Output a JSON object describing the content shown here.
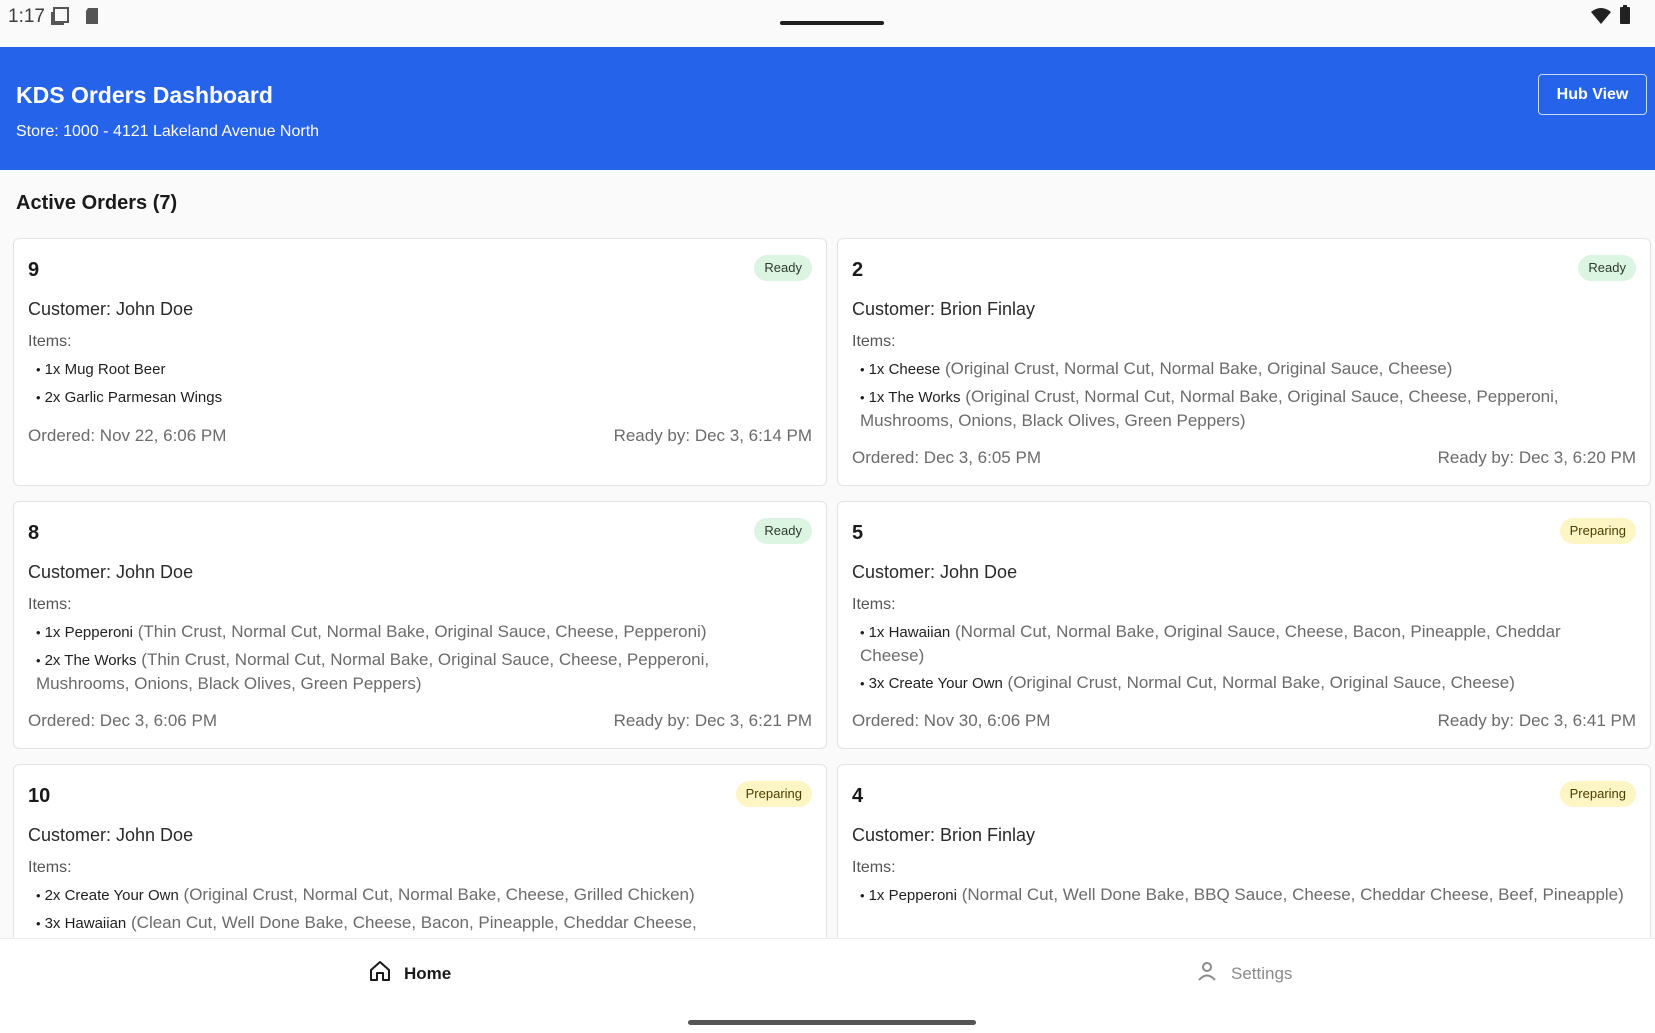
{
  "status_bar": {
    "time": "1:17"
  },
  "header": {
    "title": "KDS Orders Dashboard",
    "subtitle": "Store: 1000 - 4121 Lakeland Avenue North",
    "hub_button": "Hub View"
  },
  "section_title": "Active Orders (7)",
  "labels": {
    "items": "Items:"
  },
  "orders": [
    {
      "number": "9",
      "status": "Ready",
      "customer": "Customer: John Doe",
      "items": [
        {
          "name": "1x Mug Root Beer",
          "details": ""
        },
        {
          "name": "2x Garlic Parmesan Wings",
          "details": ""
        }
      ],
      "ordered": "Ordered: Nov 22, 6:06 PM",
      "ready_by": "Ready by: Dec 3, 6:14 PM"
    },
    {
      "number": "2",
      "status": "Ready",
      "customer": "Customer: Brion Finlay",
      "items": [
        {
          "name": "1x Cheese",
          "details": "(Original Crust, Normal Cut, Normal Bake, Original Sauce, Cheese)"
        },
        {
          "name": "1x The Works",
          "details": "(Original Crust, Normal Cut, Normal Bake, Original Sauce, Cheese, Pepperoni, Mushrooms, Onions, Black Olives, Green Peppers)"
        }
      ],
      "ordered": "Ordered: Dec 3, 6:05 PM",
      "ready_by": "Ready by: Dec 3, 6:20 PM"
    },
    {
      "number": "8",
      "status": "Ready",
      "customer": "Customer: John Doe",
      "items": [
        {
          "name": "1x Pepperoni",
          "details": "(Thin Crust, Normal Cut, Normal Bake, Original Sauce, Cheese, Pepperoni)"
        },
        {
          "name": "2x The Works",
          "details": "(Thin Crust, Normal Cut, Normal Bake, Original Sauce, Cheese, Pepperoni, Mushrooms, Onions, Black Olives, Green Peppers)"
        }
      ],
      "ordered": "Ordered: Dec 3, 6:06 PM",
      "ready_by": "Ready by: Dec 3, 6:21 PM"
    },
    {
      "number": "5",
      "status": "Preparing",
      "customer": "Customer: John Doe",
      "items": [
        {
          "name": "1x  Hawaiian",
          "details": "(Normal Cut, Normal Bake, Original Sauce, Cheese, Bacon, Pineapple, Cheddar Cheese)"
        },
        {
          "name": "3x Create Your Own",
          "details": "(Original Crust, Normal Cut, Normal Bake, Original Sauce, Cheese)"
        }
      ],
      "ordered": "Ordered: Nov 30, 6:06 PM",
      "ready_by": "Ready by: Dec 3, 6:41 PM"
    },
    {
      "number": "10",
      "status": "Preparing",
      "customer": "Customer: John Doe",
      "items": [
        {
          "name": "2x Create Your Own",
          "details": "(Original Crust, Normal Cut, Normal Bake, Cheese, Grilled Chicken)"
        },
        {
          "name": "3x  Hawaiian",
          "details": "(Clean Cut, Well Done Bake, Cheese, Bacon, Pineapple, Cheddar Cheese,"
        }
      ],
      "ordered": "",
      "ready_by": ""
    },
    {
      "number": "4",
      "status": "Preparing",
      "customer": "Customer: Brion Finlay",
      "items": [
        {
          "name": "1x Pepperoni",
          "details": "(Normal Cut, Well Done Bake, BBQ Sauce, Cheese, Cheddar Cheese, Beef, Pineapple)"
        }
      ],
      "ordered": "",
      "ready_by": ""
    }
  ],
  "nav": {
    "home": "Home",
    "settings": "Settings"
  },
  "colors": {
    "header_bg": "#2563eb",
    "ready_badge": "#dcf5e3",
    "preparing_badge": "#fdf5c4"
  }
}
